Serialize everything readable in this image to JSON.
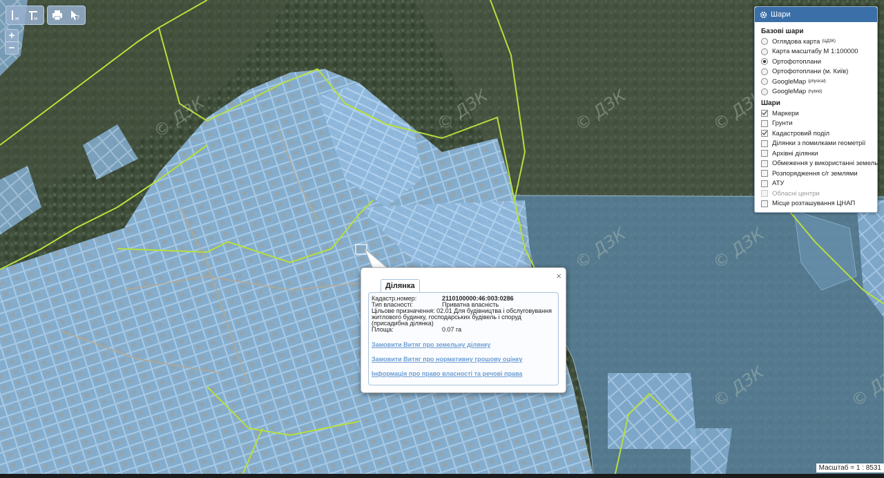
{
  "toolbar": {
    "buttons": [
      {
        "name": "measure-length-icon"
      },
      {
        "name": "measure-area-icon"
      },
      {
        "name": "print-icon"
      },
      {
        "name": "identify-icon"
      }
    ],
    "zoom_in": "+",
    "zoom_out": "−"
  },
  "layers_panel": {
    "title": "Шари",
    "base_title": "Базові шари",
    "base_layers": [
      {
        "label": "Оглядова карта",
        "sup": "(ЦДЗК)",
        "selected": false
      },
      {
        "label": "Карта масштабу М 1:100000",
        "sup": "",
        "selected": false
      },
      {
        "label": "Ортофотоплани",
        "sup": "",
        "selected": true
      },
      {
        "label": "Ортофотоплани (м. Київ)",
        "sup": "",
        "selected": false
      },
      {
        "label": "GoogleMap",
        "sup": "(physical)",
        "selected": false
      },
      {
        "label": "GoogleMap",
        "sup": "(hybrid)",
        "selected": false
      }
    ],
    "overlay_title": "Шари",
    "overlays": [
      {
        "label": "Маркери",
        "checked": true,
        "disabled": false
      },
      {
        "label": "Грунти",
        "checked": false,
        "disabled": false
      },
      {
        "label": "Кадастровий поділ",
        "checked": true,
        "disabled": false
      },
      {
        "label": "Ділянки з помилками геометрії",
        "checked": false,
        "disabled": false
      },
      {
        "label": "Архівні ділянки",
        "checked": false,
        "disabled": false
      },
      {
        "label": "Обмеження у використанні земель",
        "checked": false,
        "disabled": false
      },
      {
        "label": "Розпорядження с/г землями",
        "checked": false,
        "disabled": false
      },
      {
        "label": "АТУ",
        "checked": false,
        "disabled": false
      },
      {
        "label": "Обласні центри",
        "checked": false,
        "disabled": true
      },
      {
        "label": "Місце розташування ЦНАП",
        "checked": false,
        "disabled": false
      }
    ]
  },
  "popup": {
    "close": "×",
    "tab": "Ділянка",
    "fields": {
      "cadastre_label": "Кадастр.номер:",
      "cadastre_value": "2110100000:46:003:0286",
      "ownership_label": "Тип власності:",
      "ownership_value": "Приватна власність",
      "purpose_label": "Цільове призначення:",
      "purpose_value": "02.01 Для будівництва і обслуговування житлового будинку, господарських будівель і споруд (присадибна ділянка)",
      "area_label": "Площа:",
      "area_value": "0.07 га"
    },
    "links": [
      "Замовити Витяг про земельну ділянку",
      "Замовити Витяг про нормативну грошову оцінку",
      "Інформація про право власності та речові права"
    ]
  },
  "map": {
    "watermark": "© ДЗК",
    "scale_text": "Масштаб = 1 : 8531"
  }
}
